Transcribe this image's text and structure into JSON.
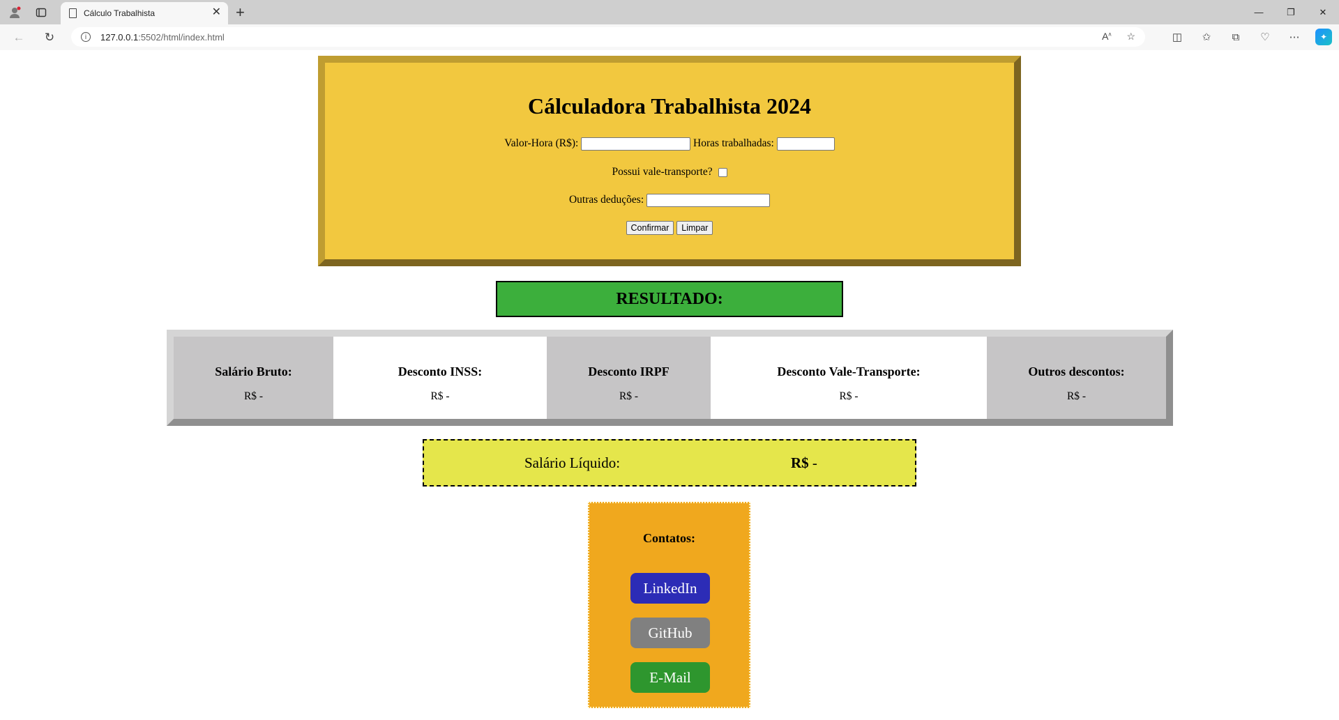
{
  "browser": {
    "tab_title": "Cálculo Trabalhista",
    "url_host": "127.0.0.1",
    "url_path": ":5502/html/index.html"
  },
  "calculator": {
    "title": "Cálculadora Trabalhista 2024",
    "valor_hora_label": "Valor-Hora (R$):",
    "horas_label": "Horas trabalhadas:",
    "vale_label": "Possui vale-transporte?",
    "outras_label": "Outras deduções:",
    "confirm_button": "Confirmar",
    "clear_button": "Limpar"
  },
  "resultado": "RESULTADO:",
  "results": [
    {
      "label": "Salário Bruto:",
      "value": "R$ -"
    },
    {
      "label": "Desconto INSS:",
      "value": "R$ -"
    },
    {
      "label": "Desconto IRPF",
      "value": "R$ -"
    },
    {
      "label": "Desconto Vale-Transporte:",
      "value": "R$ -"
    },
    {
      "label": "Outros descontos:",
      "value": "R$ -"
    }
  ],
  "liquido": {
    "label": "Salário Líquido:",
    "currency": "R$",
    "value": " -"
  },
  "contatos": {
    "title": "Contatos:",
    "linkedin": "LinkedIn",
    "github": "GitHub",
    "email": "E-Mail"
  },
  "colors": {
    "calc_bg": "#f2c83f",
    "resultado_bg": "#3caf3c",
    "liquido_bg": "#e5e64b",
    "contatos_bg": "#f0a81e",
    "linkedin": "#2c2cb6",
    "github": "#808080",
    "email": "#2e962e"
  }
}
